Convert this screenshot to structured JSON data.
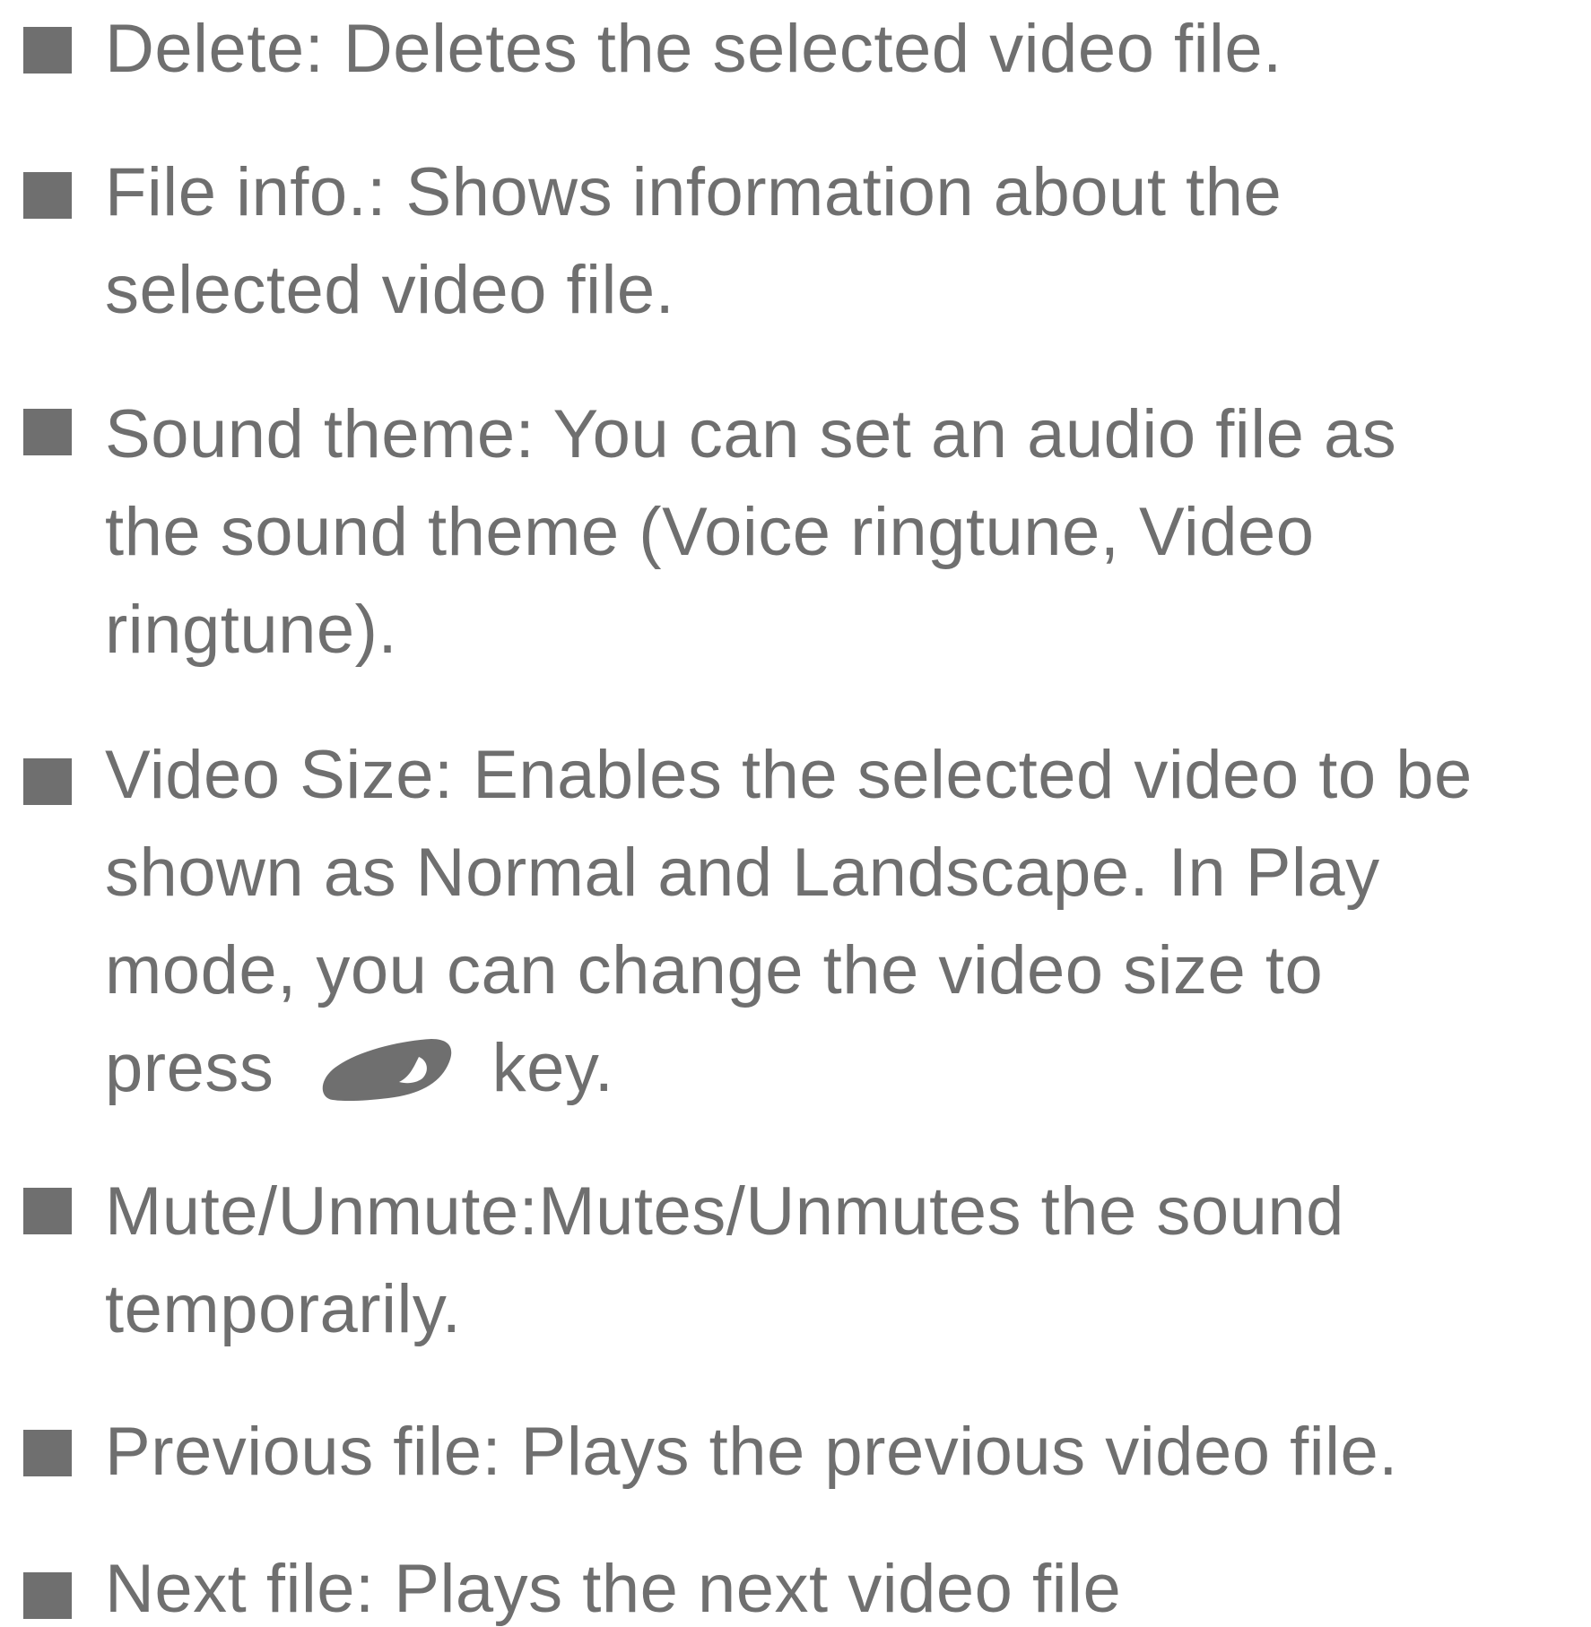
{
  "items": [
    {
      "name": "delete",
      "lines": [
        "Delete: Deletes the selected video file."
      ]
    },
    {
      "name": "file-info",
      "lines": [
        "File info.: Shows information about the",
        "selected video file."
      ]
    },
    {
      "name": "sound-theme",
      "lines": [
        "Sound theme: You can set an audio file as",
        "the sound theme (Voice ringtune, Video",
        "ringtune)."
      ]
    },
    {
      "name": "video-size",
      "lines": [
        "Video Size: Enables the selected video to be",
        "shown as Normal and Landscape. In Play",
        "mode, you can change the video size to"
      ],
      "last_line_before": "press",
      "key_icon": "soft-key-icon",
      "last_line_after": "key."
    },
    {
      "name": "mute-unmute",
      "lines": [
        "Mute/Unmute:Mutes/Unmutes the sound",
        "temporarily."
      ]
    },
    {
      "name": "previous-file",
      "lines": [
        "Previous file: Plays the previous video file."
      ]
    },
    {
      "name": "next-file",
      "lines": [
        "Next file: Plays the next video file"
      ]
    }
  ],
  "colors": {
    "text": "#6f6f6f",
    "bullet": "#6f6f6f",
    "background": "#ffffff"
  }
}
